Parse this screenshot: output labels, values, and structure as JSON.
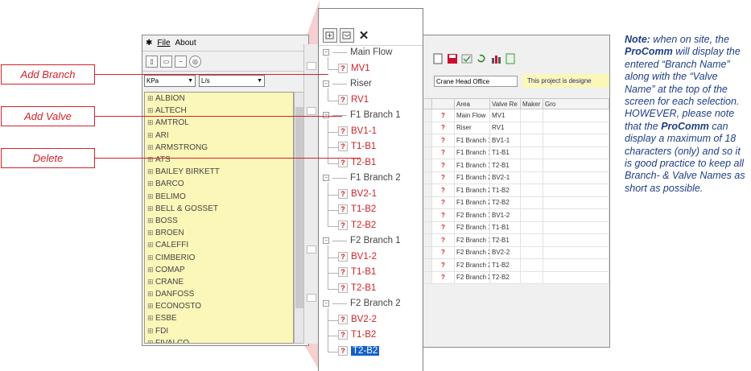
{
  "callouts": {
    "add_branch": "Add Branch",
    "add_valve": "Add Valve",
    "delete": "Delete"
  },
  "left_window": {
    "menu": {
      "file": "File",
      "about": "About"
    },
    "units": {
      "pressure": "KPa",
      "flow": "L/s"
    },
    "manufacturers": [
      "ALBION",
      "ALTECH",
      "AMTROL",
      "ARI",
      "ARMSTRONG",
      "ATS",
      "BAILEY BIRKETT",
      "BARCO",
      "BELIMO",
      "BELL & GOSSET",
      "BOSS",
      "BROEN",
      "CALEFFI",
      "CIMBERIO",
      "COMAP",
      "CRANE",
      "DANFOSS",
      "ECONOSTO",
      "ESBE",
      "FDI",
      "FIVALCO"
    ]
  },
  "tree": {
    "nodes": [
      {
        "label": "Main Flow",
        "level": 0
      },
      {
        "label": "MV1",
        "level": 1
      },
      {
        "label": "Riser",
        "level": 0
      },
      {
        "label": "RV1",
        "level": 1
      },
      {
        "label": "F1 Branch 1",
        "level": 0
      },
      {
        "label": "BV1-1",
        "level": 1
      },
      {
        "label": "T1-B1",
        "level": 1
      },
      {
        "label": "T2-B1",
        "level": 1
      },
      {
        "label": "F1 Branch 2",
        "level": 0
      },
      {
        "label": "BV2-1",
        "level": 1
      },
      {
        "label": "T1-B2",
        "level": 1
      },
      {
        "label": "T2-B2",
        "level": 1
      },
      {
        "label": "F2 Branch 1",
        "level": 0
      },
      {
        "label": "BV1-2",
        "level": 1
      },
      {
        "label": "T1-B1",
        "level": 1
      },
      {
        "label": "T2-B1",
        "level": 1
      },
      {
        "label": "F2 Branch 2",
        "level": 0
      },
      {
        "label": "BV2-2",
        "level": 1
      },
      {
        "label": "T1-B2",
        "level": 1
      },
      {
        "label": "T2-B2",
        "level": 1,
        "selected": true
      }
    ]
  },
  "right_window": {
    "project_name": "Crane Head Office",
    "project_note": "This project is designe",
    "columns": [
      "",
      "",
      "Area",
      "Valve Re",
      "Maker",
      "Gro"
    ],
    "rows": [
      [
        "?",
        "Main Flow",
        "MV1"
      ],
      [
        "?",
        "Riser",
        "RV1"
      ],
      [
        "?",
        "F1 Branch 1",
        "BV1-1"
      ],
      [
        "?",
        "F1 Branch 1",
        "T1-B1"
      ],
      [
        "?",
        "F1 Branch 1",
        "T2-B1"
      ],
      [
        "?",
        "F1 Branch 2",
        "BV2-1"
      ],
      [
        "?",
        "F1 Branch 2",
        "T1-B2"
      ],
      [
        "?",
        "F1 Branch 2",
        "T2-B2"
      ],
      [
        "?",
        "F2 Branch 1",
        "BV1-2"
      ],
      [
        "?",
        "F2 Branch 1",
        "T1-B1"
      ],
      [
        "?",
        "F2 Branch 1",
        "T2-B1"
      ],
      [
        "?",
        "F2 Branch 2",
        "BV2-2"
      ],
      [
        "?",
        "F2 Branch 2",
        "T1-B2"
      ],
      [
        "?",
        "F2 Branch 2",
        "T2-B2"
      ]
    ]
  },
  "note": {
    "lead": "Note:",
    "t1": " when on site, the ",
    "pc1": "ProComm",
    "t2": " will display the entered “Branch Name” along with the “Valve Name” at the top of the screen for each selection. HOWEVER, please note that the ",
    "pc2": "ProComm",
    "t3": " can display a maximum of 18 characters (only) and so it is good practice to keep all Branch- & Valve Names as short as possible."
  }
}
